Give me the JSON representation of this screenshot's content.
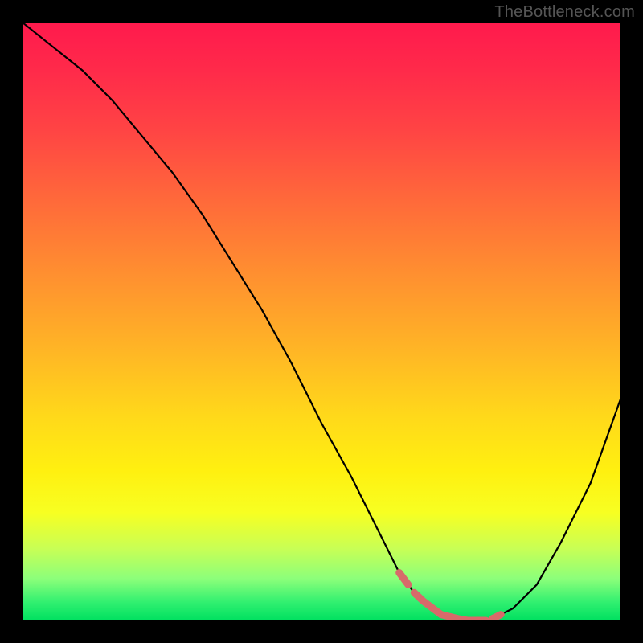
{
  "watermark": "TheBottleneck.com",
  "colors": {
    "frame": "#000000",
    "highlight": "#d86a6a",
    "curve": "#000000"
  },
  "chart_data": {
    "type": "line",
    "title": "",
    "xlabel": "",
    "ylabel": "",
    "xlim": [
      0,
      100
    ],
    "ylim": [
      0,
      100
    ],
    "grid": false,
    "legend": false,
    "series": [
      {
        "name": "bottleneck-curve",
        "x": [
          0,
          5,
          10,
          15,
          20,
          25,
          30,
          35,
          40,
          45,
          50,
          55,
          60,
          63,
          66,
          70,
          74,
          78,
          82,
          86,
          90,
          95,
          100
        ],
        "values": [
          100,
          96,
          92,
          87,
          81,
          75,
          68,
          60,
          52,
          43,
          33,
          24,
          14,
          8,
          4,
          1,
          0,
          0,
          2,
          6,
          13,
          23,
          37
        ]
      }
    ],
    "highlight_range": {
      "x_start": 63,
      "x_end": 80
    },
    "notes": "Black V-shaped curve over red-to-green vertical gradient; coral highlight along the valley floor near x≈63–80."
  }
}
